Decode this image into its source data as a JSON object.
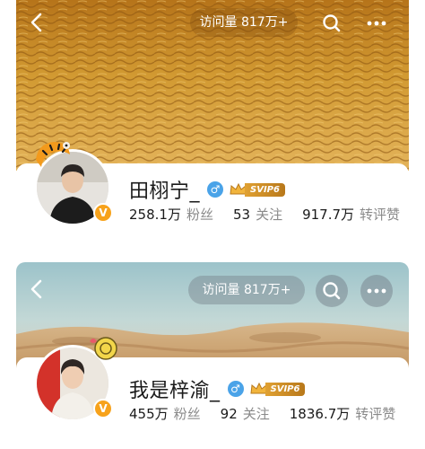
{
  "profiles": [
    {
      "back_icon": "chevron-left-icon",
      "visits_label": "访问量 817万+",
      "search_icon": "search-icon",
      "more_icon": "more-dots-icon",
      "name": "田栩宁_",
      "gender_symbol": "♂",
      "vip_badge": "SVIP6",
      "verified_symbol": "V",
      "stats": [
        {
          "value": "258.1万",
          "label": "粉丝"
        },
        {
          "value": "53",
          "label": "关注"
        },
        {
          "value": "917.7万",
          "label": "转评赞"
        }
      ],
      "colors": {
        "cover": "#c98a1e",
        "verified": "#f7a21b",
        "gender": "#4aa3e8"
      }
    },
    {
      "back_icon": "chevron-left-icon",
      "visits_label": "访问量 817万+",
      "search_icon": "search-icon",
      "more_icon": "more-dots-icon",
      "name": "我是梓渝_",
      "gender_symbol": "♂",
      "vip_badge": "SVIP6",
      "verified_symbol": "V",
      "stats": [
        {
          "value": "455万",
          "label": "粉丝"
        },
        {
          "value": "92",
          "label": "关注"
        },
        {
          "value": "1836.7万",
          "label": "转评赞"
        }
      ],
      "colors": {
        "cover_sky": "#a9c9cf",
        "cover_sand": "#c9a47a",
        "verified": "#f7a21b",
        "gender": "#4aa3e8"
      }
    }
  ]
}
